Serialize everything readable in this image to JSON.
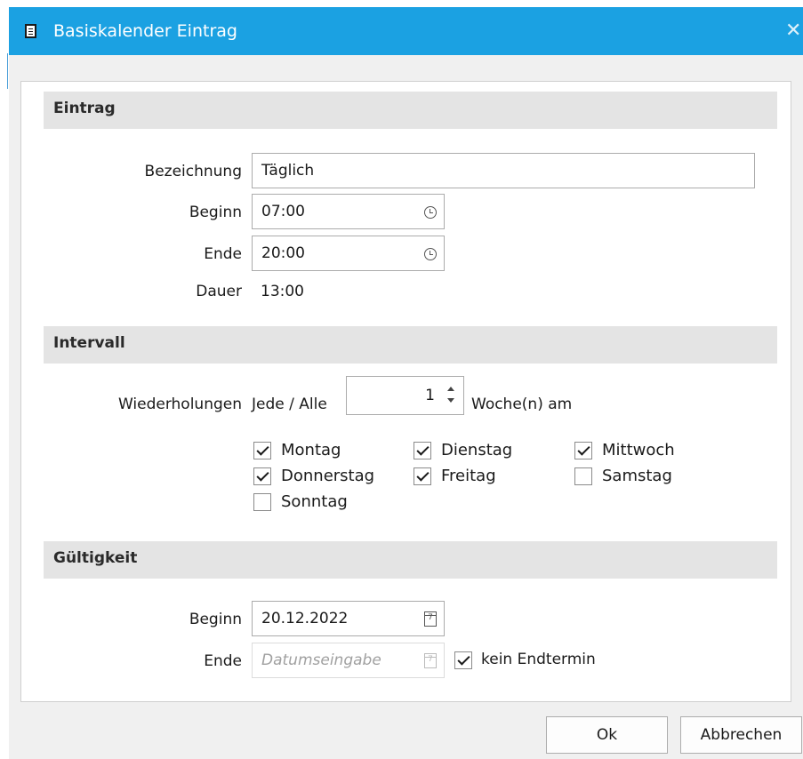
{
  "window": {
    "title": "Basiskalender Eintrag"
  },
  "sections": {
    "eintrag": "Eintrag",
    "intervall": "Intervall",
    "gueltigkeit": "Gültigkeit"
  },
  "eintrag": {
    "bezeichnung_label": "Bezeichnung",
    "bezeichnung_value": "Täglich",
    "beginn_label": "Beginn",
    "beginn_value": "07:00",
    "ende_label": "Ende",
    "ende_value": "20:00",
    "dauer_label": "Dauer",
    "dauer_value": "13:00"
  },
  "intervall": {
    "wiederholungen_label": "Wiederholungen",
    "jede_label": "Jede / Alle",
    "count_value": "1",
    "unit_label": "Woche(n) am",
    "days": [
      {
        "label": "Montag",
        "checked": true
      },
      {
        "label": "Dienstag",
        "checked": true
      },
      {
        "label": "Mittwoch",
        "checked": true
      },
      {
        "label": "Donnerstag",
        "checked": true
      },
      {
        "label": "Freitag",
        "checked": true
      },
      {
        "label": "Samstag",
        "checked": false
      },
      {
        "label": "Sonntag",
        "checked": false
      }
    ]
  },
  "gueltigkeit": {
    "beginn_label": "Beginn",
    "beginn_value": "20.12.2022",
    "ende_label": "Ende",
    "ende_placeholder": "Datumseingabe",
    "kein_endtermin_label": "kein Endtermin",
    "kein_endtermin_checked": true
  },
  "buttons": {
    "ok": "Ok",
    "cancel": "Abbrechen"
  },
  "colors": {
    "titlebar": "#1ba1e2",
    "section_header": "#e4e4e4"
  },
  "icons": {
    "title": "document-list-icon",
    "close": "close-icon",
    "time": "clock-icon",
    "date": "calendar-icon"
  }
}
